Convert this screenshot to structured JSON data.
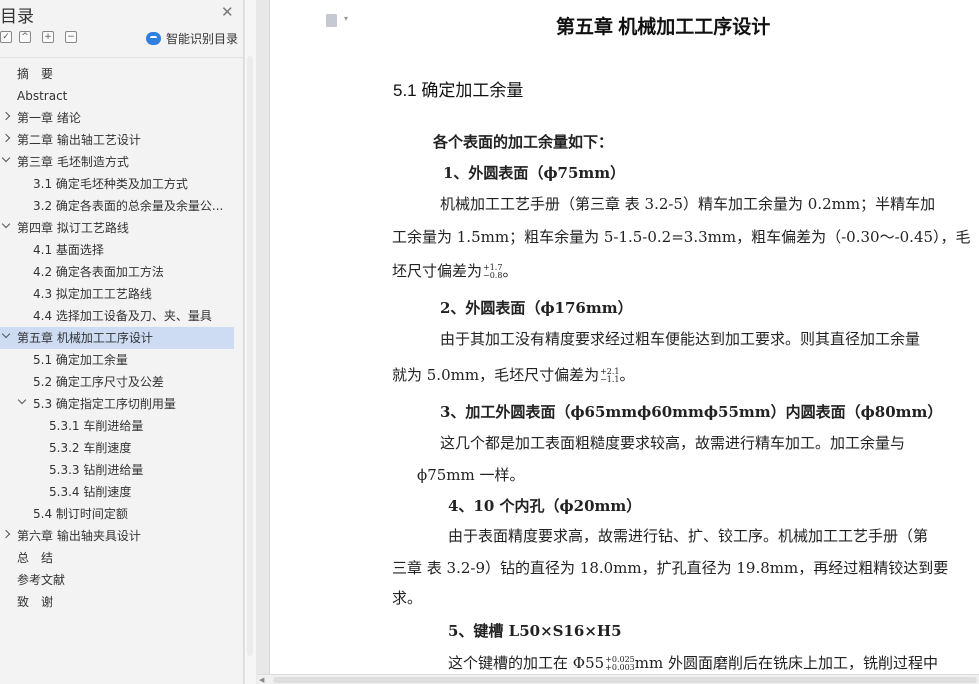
{
  "sidebar": {
    "title": "目录",
    "smart_label": "智能识别目录",
    "tools": [
      "✓",
      "^",
      "+",
      "−"
    ],
    "toc": [
      {
        "label": "摘　要",
        "level": 0,
        "expander": "none",
        "active": false
      },
      {
        "label": "Abstract",
        "level": 0,
        "expander": "none",
        "active": false
      },
      {
        "label": "第一章  绪论",
        "level": 0,
        "expander": "right",
        "active": false
      },
      {
        "label": "第二章  输出轴工艺设计",
        "level": 0,
        "expander": "right",
        "active": false
      },
      {
        "label": "第三章  毛坯制造方式",
        "level": 0,
        "expander": "down",
        "active": false
      },
      {
        "label": "3.1 确定毛坯种类及加工方式",
        "level": 1,
        "expander": "none",
        "active": false
      },
      {
        "label": "3.2 确定各表面的总余量及余量公...",
        "level": 1,
        "expander": "none",
        "active": false
      },
      {
        "label": "第四章  拟订工艺路线",
        "level": 0,
        "expander": "down",
        "active": false
      },
      {
        "label": "4.1 基面选择",
        "level": 1,
        "expander": "none",
        "active": false
      },
      {
        "label": "4.2 确定各表面加工方法",
        "level": 1,
        "expander": "none",
        "active": false
      },
      {
        "label": "4.3 拟定加工工艺路线",
        "level": 1,
        "expander": "none",
        "active": false
      },
      {
        "label": "4.4 选择加工设备及刀、夹、量具",
        "level": 1,
        "expander": "none",
        "active": false
      },
      {
        "label": "第五章  机械加工工序设计",
        "level": 0,
        "expander": "down",
        "active": true
      },
      {
        "label": "5.1 确定加工余量",
        "level": 1,
        "expander": "none",
        "active": false
      },
      {
        "label": "5.2 确定工序尺寸及公差",
        "level": 1,
        "expander": "none",
        "active": false
      },
      {
        "label": "5.3 确定指定工序切削用量",
        "level": 1,
        "expander": "down",
        "active": false
      },
      {
        "label": "5.3.1 车削进给量",
        "level": 2,
        "expander": "none",
        "active": false
      },
      {
        "label": "5.3.2 车削速度",
        "level": 2,
        "expander": "none",
        "active": false
      },
      {
        "label": "5.3.3 钻削进给量",
        "level": 2,
        "expander": "none",
        "active": false
      },
      {
        "label": "5.3.4 钻削速度",
        "level": 2,
        "expander": "none",
        "active": false
      },
      {
        "label": "5.4 制订时间定额",
        "level": 1,
        "expander": "none",
        "active": false
      },
      {
        "label": "第六章  输出轴夹具设计",
        "level": 0,
        "expander": "right",
        "active": false
      },
      {
        "label": "总　结",
        "level": 0,
        "expander": "none",
        "active": false
      },
      {
        "label": "参考文献",
        "level": 0,
        "expander": "none",
        "active": false
      },
      {
        "label": "致　谢",
        "level": 0,
        "expander": "none",
        "active": false
      }
    ]
  },
  "doc": {
    "chapter": "第五章  机械加工工序设计",
    "section": "5.1 确定加工余量",
    "intro": "各个表面的加工余量如下：",
    "h1": "1、外圆表面（ϕ75mm）",
    "p1a": "机械加工工艺手册（第三章 表 3.2-5）精车加工余量为 0.2mm；半精车加",
    "p1b": "工余量为 1.5mm；粗车余量为 5-1.5-0.2=3.3mm，粗车偏差为（-0.30～-0.45），毛",
    "p1c": "坯尺寸偏差为",
    "p1c_sup": "+1.7",
    "p1c_sub": "−0.8",
    "p1c_end": "。",
    "h2": "2、外圆表面（ϕ176mm）",
    "p2a": "由于其加工没有精度要求经过粗车便能达到加工要求。则其直径加工余量",
    "p2b": "就为 5.0mm，毛坯尺寸偏差为",
    "p2b_sup": "+2.1",
    "p2b_sub": "−1.1",
    "p2b_end": "。",
    "h3": "3、加工外圆表面（ϕ65mmϕ60mmϕ55mm）内圆表面（ϕ80mm）",
    "p3a": "这几个都是加工表面粗糙度要求较高，故需进行精车加工。加工余量与",
    "p3b": "ϕ75mm 一样。",
    "h4": "4、10 个内孔（ϕ20mm）",
    "p4a": "由于表面精度要求高，故需进行钻、扩、铰工序。机械加工工艺手册（第",
    "p4b": "三章 表 3.2-9）钻的直径为 18.0mm，扩孔直径为 19.8mm，再经过粗精铰达到要",
    "p4c": "求。",
    "h5": "5、键槽 L50×S16×H5",
    "p5a_pre": "这个键槽的加工在 Φ55",
    "p5a_sup": "+0.025",
    "p5a_sub": "+0.003",
    "p5a_post": "mm 外圆面磨削后在铣床上加工，铣削过程中"
  }
}
